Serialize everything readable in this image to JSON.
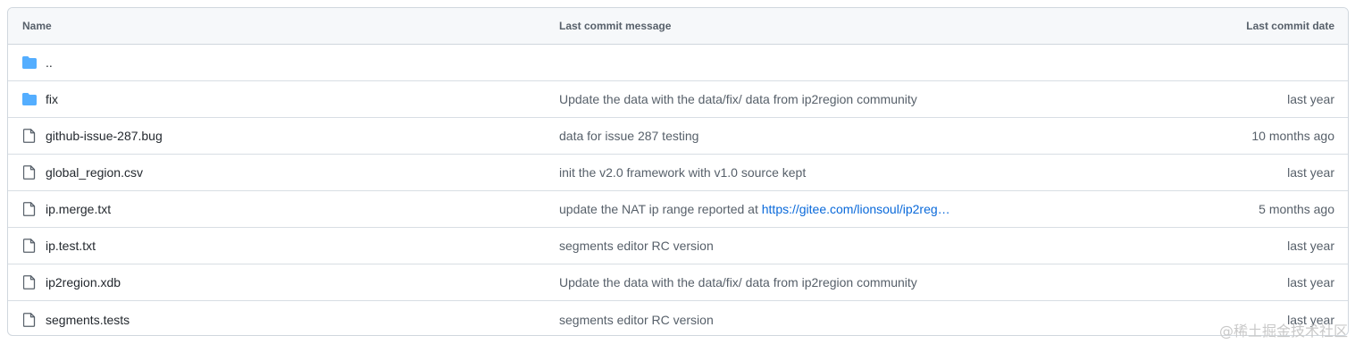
{
  "table": {
    "headers": {
      "name": "Name",
      "message": "Last commit message",
      "date": "Last commit date"
    },
    "rows": [
      {
        "type": "folder",
        "icon": "folder-icon",
        "name": "..",
        "message": "",
        "date": ""
      },
      {
        "type": "folder",
        "icon": "folder-icon",
        "name": "fix",
        "message": "Update the data with the data/fix/ data from ip2region community",
        "date": "last year"
      },
      {
        "type": "file",
        "icon": "file-icon",
        "name": "github-issue-287.bug",
        "message": "data for issue 287 testing",
        "date": "10 months ago"
      },
      {
        "type": "file",
        "icon": "file-icon",
        "name": "global_region.csv",
        "message": "init the v2.0 framework with v1.0 source kept",
        "date": "last year"
      },
      {
        "type": "file",
        "icon": "file-icon",
        "name": "ip.merge.txt",
        "message": "update the NAT ip range reported at ",
        "message_link": "https://gitee.com/lionsoul/ip2reg…",
        "date": "5 months ago"
      },
      {
        "type": "file",
        "icon": "file-icon",
        "name": "ip.test.txt",
        "message": "segments editor RC version",
        "date": "last year"
      },
      {
        "type": "file",
        "icon": "file-icon",
        "name": "ip2region.xdb",
        "message": "Update the data with the data/fix/ data from ip2region community",
        "date": "last year"
      },
      {
        "type": "file",
        "icon": "file-icon",
        "name": "segments.tests",
        "message": "segments editor RC version",
        "date": "last year"
      }
    ]
  },
  "colors": {
    "folder": "#54aeff",
    "file": "#57606a",
    "link": "#0969da"
  },
  "watermark": "@稀土掘金技术社区"
}
